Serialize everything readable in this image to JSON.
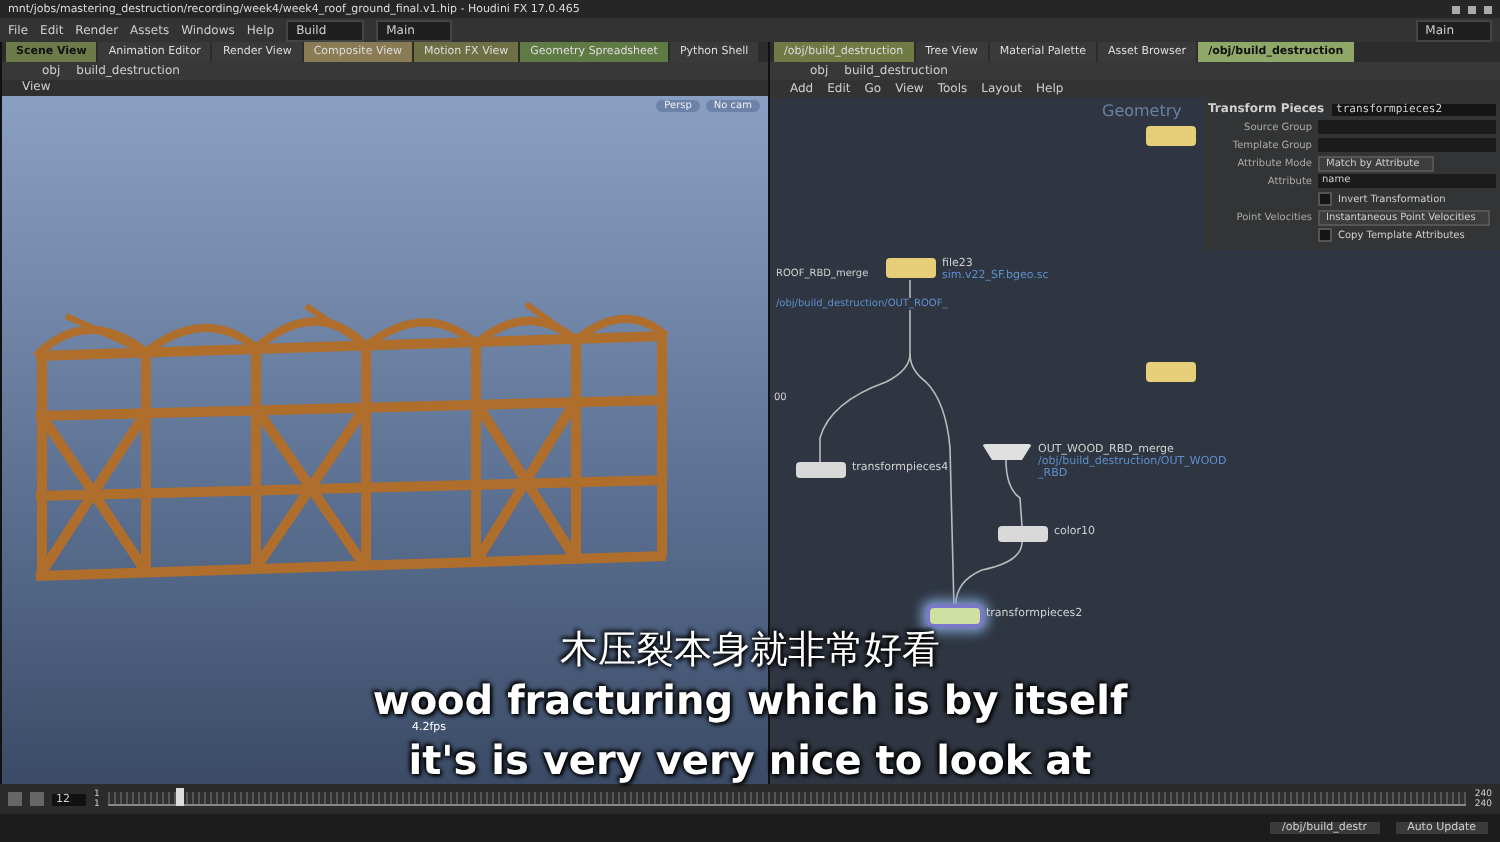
{
  "window": {
    "title": "mnt/jobs/mastering_destruction/recording/week4/week4_roof_ground_final.v1.hip - Houdini FX 17.0.465"
  },
  "menu": [
    "File",
    "Edit",
    "Render",
    "Assets",
    "Windows",
    "Help"
  ],
  "desktops": {
    "build": "Build",
    "shelf": "Main",
    "desktop": "Main"
  },
  "left_pane": {
    "tabs": [
      {
        "label": "Scene View",
        "selected": true,
        "color": "#6d7a4a"
      },
      {
        "label": "Animation Editor",
        "selected": false,
        "color": "#3a3a3a"
      },
      {
        "label": "Render View",
        "selected": false,
        "color": "#3a3a3a"
      },
      {
        "label": "Composite View",
        "selected": false,
        "color": "#8a7b55"
      },
      {
        "label": "Motion FX View",
        "selected": false,
        "color": "#6f6f45"
      },
      {
        "label": "Geometry Spreadsheet",
        "selected": false,
        "color": "#5f7a45"
      },
      {
        "label": "Python Shell",
        "selected": false,
        "color": "#3a3a3a"
      }
    ],
    "path": [
      "obj",
      "build_destruction"
    ],
    "view_label": "View",
    "camera_menus": [
      "Persp",
      "No cam"
    ],
    "fps": "4.2fps"
  },
  "right_pane": {
    "tabs": [
      {
        "label": "/obj/build_destruction",
        "selected": false,
        "color": "#6f7a45"
      },
      {
        "label": "Tree View",
        "selected": false,
        "color": "#3a3a3a"
      },
      {
        "label": "Material Palette",
        "selected": false,
        "color": "#3a3a3a"
      },
      {
        "label": "Asset Browser",
        "selected": false,
        "color": "#3a3a3a"
      },
      {
        "label": "/obj/build_destruction",
        "selected": true,
        "color": "#8fa86a"
      }
    ],
    "path": [
      "obj",
      "build_destruction"
    ],
    "menu": [
      "Add",
      "Edit",
      "Go",
      "View",
      "Tools",
      "Layout",
      "Help"
    ],
    "network_label": "Geometry",
    "labels": [
      {
        "kind": "name",
        "text": "ROOF_RBD_merge"
      },
      {
        "kind": "path",
        "text": "/obj/build_destruction/OUT_ROOF_"
      },
      {
        "kind": "name",
        "text": "00"
      }
    ],
    "nodes": [
      {
        "kind": "file",
        "selected": false
      },
      {
        "kind": "file",
        "selected": false
      },
      {
        "kind": "file",
        "name": "file23",
        "lines": [
          "sim.v22_SF.bgeo.sc"
        ],
        "selected": false
      },
      {
        "kind": "sop",
        "name": "transformpieces4",
        "selected": false
      },
      {
        "kind": "merge",
        "name": "OUT_WOOD_RBD_merge",
        "lines": [
          "/obj/build_destruction/OUT_WOOD",
          "_RBD"
        ],
        "selected": false
      },
      {
        "kind": "sop",
        "name": "color10",
        "selected": false
      },
      {
        "kind": "sop",
        "name": "transformpieces2",
        "selected": true
      }
    ],
    "parameters": {
      "title": "Transform Pieces",
      "node_name": "transformpieces2",
      "rows": [
        {
          "kind": "field",
          "label": "Source Group"
        },
        {
          "kind": "field",
          "label": "Template Group"
        },
        {
          "kind": "menu",
          "label": "Attribute Mode",
          "value": "Match by Attribute"
        },
        {
          "kind": "field",
          "label": "Attribute",
          "value": "name"
        },
        {
          "kind": "checkbox",
          "label": "Invert Transformation",
          "checked": false
        },
        {
          "kind": "menu",
          "label": "Point Velocities",
          "value": "Instantaneous Point Velocities"
        },
        {
          "kind": "checkbox",
          "label": "Copy Template Attributes",
          "checked": false
        }
      ]
    }
  },
  "timeline": {
    "frame": "12",
    "start": [
      "1",
      "1"
    ],
    "end": [
      "240",
      "240"
    ],
    "level": 0.05
  },
  "status": {
    "path": "/obj/build_destr",
    "update_mode": "Auto Update"
  },
  "subtitles": [
    "木压裂本身就非常好看",
    "wood fracturing which is by itself",
    "it's is very very nice to look at"
  ]
}
